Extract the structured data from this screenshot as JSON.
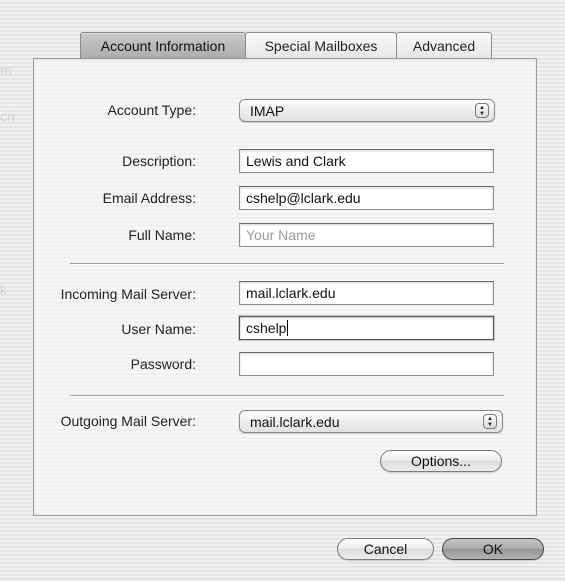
{
  "tabs": [
    {
      "label": "Account Information",
      "active": true
    },
    {
      "label": "Special Mailboxes",
      "active": false
    },
    {
      "label": "Advanced",
      "active": false
    }
  ],
  "account": {
    "type_label": "Account Type:",
    "type_value": "IMAP",
    "description_label": "Description:",
    "description_value": "Lewis and Clark",
    "email_label": "Email Address:",
    "email_value": "cshelp@lclark.edu",
    "fullname_label": "Full Name:",
    "fullname_value": "",
    "fullname_placeholder": "Your Name"
  },
  "incoming": {
    "server_label": "Incoming Mail Server:",
    "server_value": "mail.lclark.edu",
    "username_label": "User Name:",
    "username_value": "cshelp",
    "password_label": "Password:",
    "password_value": ""
  },
  "outgoing": {
    "server_label": "Outgoing Mail Server:",
    "server_value": "mail.lclark.edu",
    "options_label": "Options..."
  },
  "footer": {
    "cancel_label": "Cancel",
    "ok_label": "OK"
  }
}
